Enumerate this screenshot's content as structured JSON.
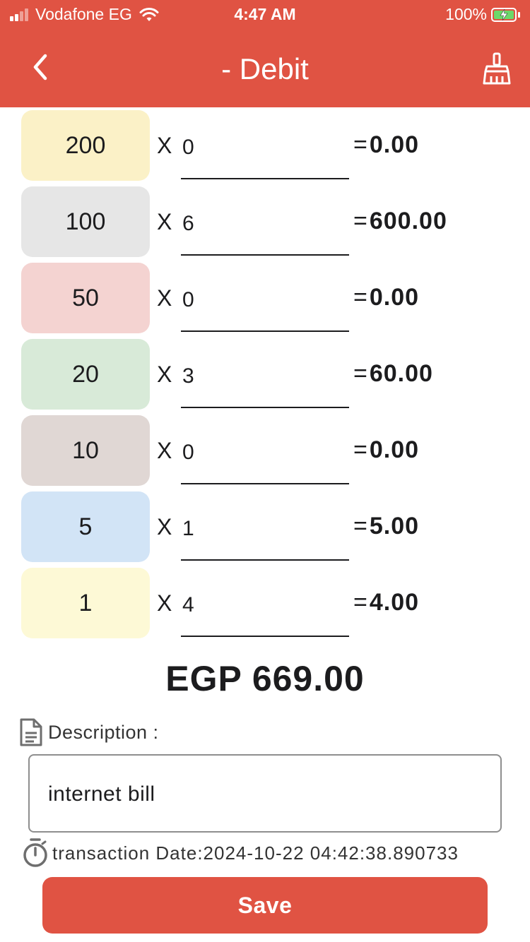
{
  "status_bar": {
    "carrier": "Vodafone EG",
    "time": "4:47 AM",
    "battery_percent": "100%",
    "signal_bars_active": 2,
    "signal_bars_total": 4
  },
  "header": {
    "title": "- Debit",
    "back_icon": "chevron-left-icon",
    "clear_icon": "broom-icon",
    "bg_color": "#e05343"
  },
  "denominations": [
    {
      "value": "200",
      "multiplier": "X",
      "quantity": "0",
      "equals": "=",
      "result": "0.00",
      "color": "#fbf1c7"
    },
    {
      "value": "100",
      "multiplier": "X",
      "quantity": "6",
      "equals": "=",
      "result": "600.00",
      "color": "#e6e6e6"
    },
    {
      "value": "50",
      "multiplier": "X",
      "quantity": "0",
      "equals": "=",
      "result": "0.00",
      "color": "#f4d3d1"
    },
    {
      "value": "20",
      "multiplier": "X",
      "quantity": "3",
      "equals": "=",
      "result": "60.00",
      "color": "#d8ead8"
    },
    {
      "value": "10",
      "multiplier": "X",
      "quantity": "0",
      "equals": "=",
      "result": "0.00",
      "color": "#e0d7d4"
    },
    {
      "value": "5",
      "multiplier": "X",
      "quantity": "1",
      "equals": "=",
      "result": "5.00",
      "color": "#d2e4f6"
    },
    {
      "value": "1",
      "multiplier": "X",
      "quantity": "4",
      "equals": "=",
      "result": "4.00",
      "color": "#fdf9d6"
    }
  ],
  "total": "EGP 669.00",
  "description": {
    "label": "Description :",
    "value": "internet bill",
    "icon": "document-icon"
  },
  "transaction_date": {
    "text": "transaction Date:2024-10-22 04:42:38.890733",
    "icon": "stopwatch-icon"
  },
  "save_button": {
    "label": "Save",
    "color": "#e05343"
  }
}
